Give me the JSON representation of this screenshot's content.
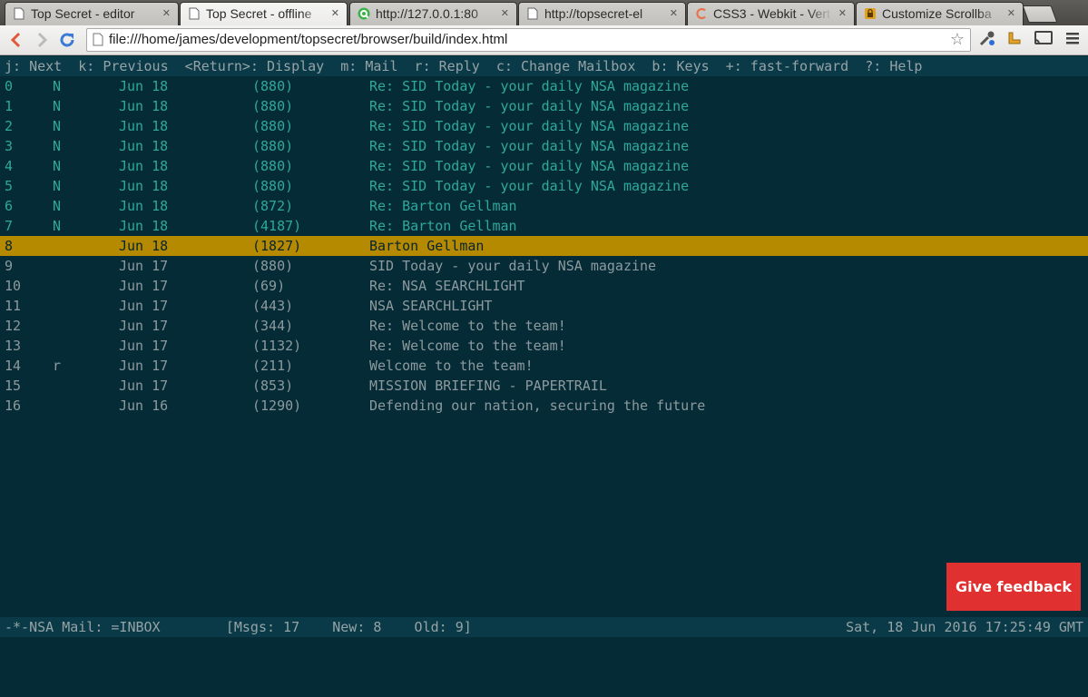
{
  "browser": {
    "tabs": [
      {
        "title": "Top Secret - editor",
        "icon": "page-icon"
      },
      {
        "title": "Top Secret - offline",
        "icon": "page-icon"
      },
      {
        "title": "http://127.0.0.1:80",
        "icon": "q-icon"
      },
      {
        "title": "http://topsecret-el",
        "icon": "page-icon"
      },
      {
        "title": "CSS3 - Webkit - Vert",
        "icon": "c-icon"
      },
      {
        "title": "Customize Scrollba",
        "icon": "lock-icon"
      }
    ],
    "active_tab": 1,
    "url": "file:///home/james/development/topsecret/browser/build/index.html"
  },
  "app": {
    "helpbar": "j: Next  k: Previous  <Return>: Display  m: Mail  r: Reply  c: Change Mailbox  b: Keys  +: fast-forward  ?: Help",
    "messages": [
      {
        "num": "0",
        "flag": "N",
        "date": "Jun 18",
        "size": "(880)",
        "subject": "Re: SID Today - your daily NSA magazine"
      },
      {
        "num": "1",
        "flag": "N",
        "date": "Jun 18",
        "size": "(880)",
        "subject": "Re: SID Today - your daily NSA magazine"
      },
      {
        "num": "2",
        "flag": "N",
        "date": "Jun 18",
        "size": "(880)",
        "subject": "Re: SID Today - your daily NSA magazine"
      },
      {
        "num": "3",
        "flag": "N",
        "date": "Jun 18",
        "size": "(880)",
        "subject": "Re: SID Today - your daily NSA magazine"
      },
      {
        "num": "4",
        "flag": "N",
        "date": "Jun 18",
        "size": "(880)",
        "subject": "Re: SID Today - your daily NSA magazine"
      },
      {
        "num": "5",
        "flag": "N",
        "date": "Jun 18",
        "size": "(880)",
        "subject": "Re: SID Today - your daily NSA magazine"
      },
      {
        "num": "6",
        "flag": "N",
        "date": "Jun 18",
        "size": "(872)",
        "subject": "Re: Barton Gellman"
      },
      {
        "num": "7",
        "flag": "N",
        "date": "Jun 18",
        "size": "(4187)",
        "subject": "Re: Barton Gellman"
      },
      {
        "num": "8",
        "flag": "",
        "date": "Jun 18",
        "size": "(1827)",
        "subject": "Barton Gellman"
      },
      {
        "num": "9",
        "flag": "",
        "date": "Jun 17",
        "size": "(880)",
        "subject": "SID Today - your daily NSA magazine"
      },
      {
        "num": "10",
        "flag": "",
        "date": "Jun 17",
        "size": "(69)",
        "subject": "Re: NSA SEARCHLIGHT"
      },
      {
        "num": "11",
        "flag": "",
        "date": "Jun 17",
        "size": "(443)",
        "subject": "NSA SEARCHLIGHT"
      },
      {
        "num": "12",
        "flag": "",
        "date": "Jun 17",
        "size": "(344)",
        "subject": "Re: Welcome to the team!"
      },
      {
        "num": "13",
        "flag": "",
        "date": "Jun 17",
        "size": "(1132)",
        "subject": "Re: Welcome to the team!"
      },
      {
        "num": "14",
        "flag": "r",
        "date": "Jun 17",
        "size": "(211)",
        "subject": "Welcome to the team!"
      },
      {
        "num": "15",
        "flag": "",
        "date": "Jun 17",
        "size": "(853)",
        "subject": "MISSION BRIEFING - PAPERTRAIL"
      },
      {
        "num": "16",
        "flag": "",
        "date": "Jun 16",
        "size": "(1290)",
        "subject": "Defending our nation, securing the future"
      }
    ],
    "selected_index": 8,
    "feedback_label": "Give feedback",
    "status": {
      "left": "-*-NSA Mail: =INBOX        [Msgs: 17    New: 8    Old: 9]",
      "right": "Sat, 18 Jun 2016 17:25:49 GMT"
    }
  },
  "colors": {
    "background": "#052b37",
    "new_message": "#2fa89b",
    "old_message": "#8d9a9d",
    "selection": "#b58900",
    "feedback": "#e0302f"
  }
}
